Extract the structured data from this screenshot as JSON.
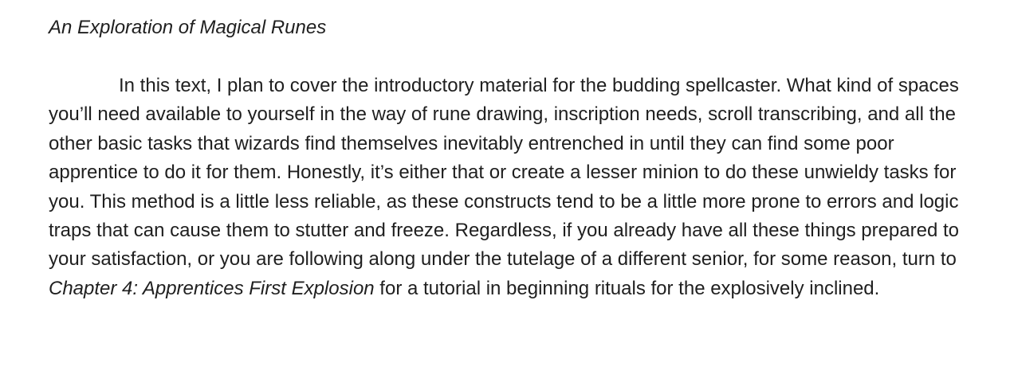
{
  "document": {
    "title": "An Exploration of Magical Runes",
    "paragraph": {
      "text_before": "In this text, I plan to cover the introductory material for the budding spellcaster. What kind of spaces you’ll need available to yourself in the way of rune drawing, inscription needs, scroll transcribing, and all the other basic tasks that wizards find themselves inevitably entrenched in until they can find some poor apprentice to do it for them. Honestly, it’s either that or create a lesser minion to do these unwieldy tasks for you. This method is a little less reliable, as these constructs tend to be a little more prone to errors and logic traps that can cause them to stutter and freeze. Regardless, if you already have all these things prepared to your satisfaction, or you are following along under the tutelage of a different senior, for some reason, turn to ",
      "chapter_reference": "Chapter 4: Apprentices First Explosion",
      "text_after": " for a tutorial in beginning rituals for the explosively inclined."
    }
  }
}
